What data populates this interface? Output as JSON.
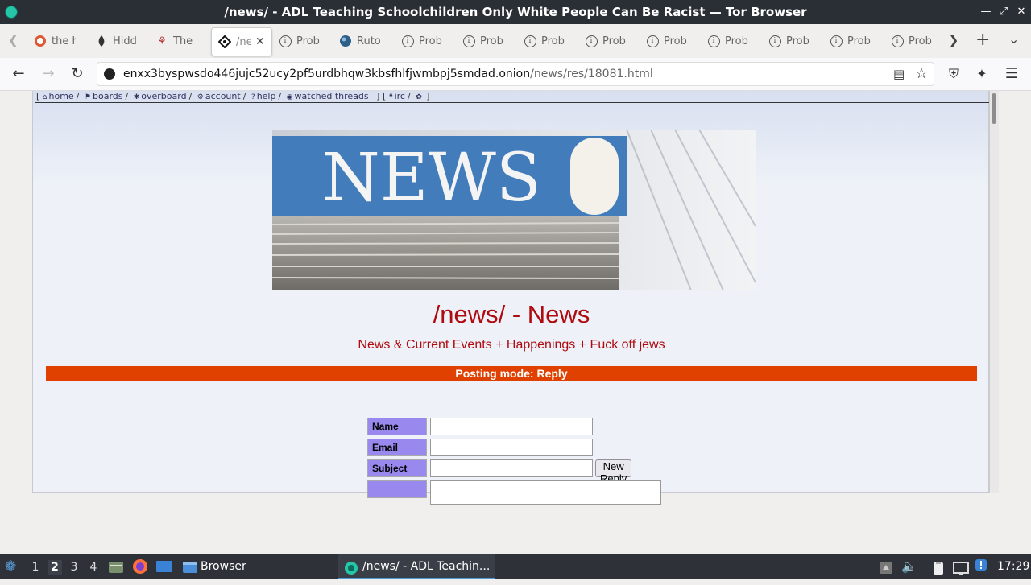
{
  "window": {
    "title": "/news/ - ADL Teaching Schoolchildren Only White People Can Be Racist — Tor Browser"
  },
  "tabs": [
    {
      "label": "the h",
      "icon": "duckduckgo-icon"
    },
    {
      "label": "Hidde",
      "icon": "onion-icon"
    },
    {
      "label": "The H",
      "icon": "site-icon"
    },
    {
      "label": "/ne",
      "icon": "board-icon",
      "active": true
    },
    {
      "label": "Probl",
      "icon": "info-icon"
    },
    {
      "label": "Ruto",
      "icon": "globe-icon"
    },
    {
      "label": "Probl",
      "icon": "info-icon"
    },
    {
      "label": "Probl",
      "icon": "info-icon"
    },
    {
      "label": "Probl",
      "icon": "info-icon"
    },
    {
      "label": "Probl",
      "icon": "info-icon"
    },
    {
      "label": "Probl",
      "icon": "info-icon"
    },
    {
      "label": "Probl",
      "icon": "info-icon"
    },
    {
      "label": "Probl",
      "icon": "info-icon"
    },
    {
      "label": "Probl",
      "icon": "info-icon"
    },
    {
      "label": "Probl",
      "icon": "info-icon"
    }
  ],
  "url": {
    "host": "enxx3byspwsdo446jujc52ucy2pf5urdbhqw3kbsfhlfjwmbpj5smdad.onion",
    "path": "/news/res/18081.html"
  },
  "boardlist": {
    "open": "[",
    "home": "home",
    "boards": "boards",
    "overboard": "overboard",
    "account": "account",
    "help": "help",
    "watched": "watched threads",
    "close_open": "] [",
    "irc": "irc",
    "close": "]"
  },
  "banner": {
    "text": "NEWS"
  },
  "board": {
    "title": "/news/ - News",
    "subtitle": "News & Current Events + Happenings + Fuck off jews",
    "posting_mode": "Posting mode: Reply"
  },
  "form": {
    "name_label": "Name",
    "email_label": "Email",
    "subject_label": "Subject",
    "submit_label": "New Reply",
    "name_value": "",
    "email_value": "",
    "subject_value": ""
  },
  "taskbar": {
    "workspaces": [
      "1",
      "2",
      "3",
      "4"
    ],
    "active_workspace": "2",
    "browser_label": "Browser",
    "active_task": "/news/ - ADL Teachin...",
    "clock": "17:29"
  },
  "colors": {
    "accent_red": "#af0a0f",
    "posting_bar": "#e04000",
    "form_label_bg": "#9988ee"
  }
}
